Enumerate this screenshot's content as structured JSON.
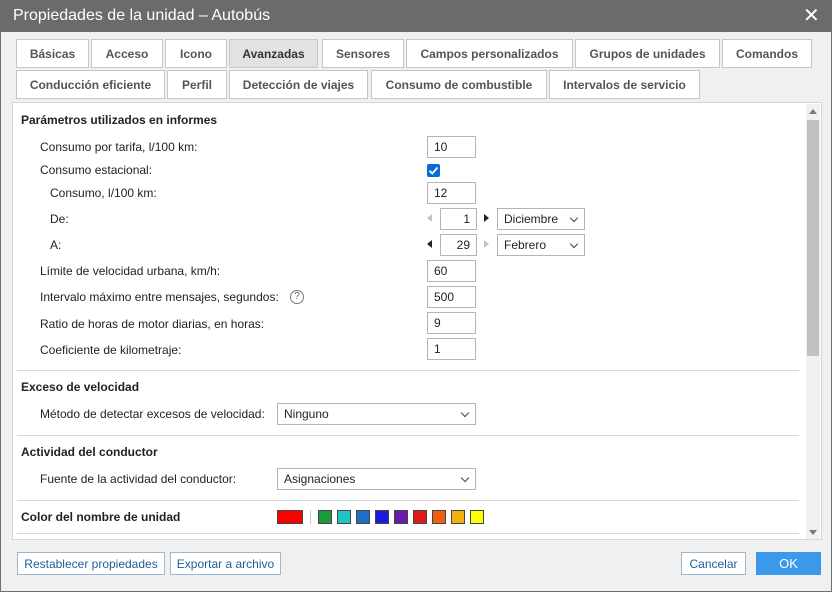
{
  "window": {
    "title": "Propiedades de la unidad – Autobús",
    "close_glyph": "✕"
  },
  "tabs": [
    {
      "label": "Básicas",
      "active": false
    },
    {
      "label": "Acceso",
      "active": false
    },
    {
      "label": "Icono",
      "active": false
    },
    {
      "label": "Avanzadas",
      "active": true
    },
    {
      "label": "Sensores",
      "active": false
    },
    {
      "label": "Campos personalizados",
      "active": false
    },
    {
      "label": "Grupos de unidades",
      "active": false
    },
    {
      "label": "Comandos",
      "active": false
    },
    {
      "label": "Conducción eficiente",
      "active": false
    },
    {
      "label": "Perfil",
      "active": false
    },
    {
      "label": "Detección de viajes",
      "active": false
    },
    {
      "label": "Consumo de combustible",
      "active": false
    },
    {
      "label": "Intervalos de servicio",
      "active": false
    }
  ],
  "report_params": {
    "title": "Parámetros utilizados en informes",
    "consumption_label": "Consumo por tarifa, l/100 km:",
    "consumption_value": "10",
    "seasonal_label": "Consumo estacional:",
    "seasonal_checked": true,
    "seasonal_consumption_label": "Consumo, l/100 km:",
    "seasonal_consumption_value": "12",
    "from_label": "De:",
    "from_day": "1",
    "from_month": "Diciembre",
    "to_label": "A:",
    "to_day": "29",
    "to_month": "Febrero",
    "urban_speed_label": "Límite de velocidad urbana, km/h:",
    "urban_speed_value": "60",
    "max_interval_label": "Intervalo máximo entre mensajes, segundos:",
    "max_interval_help": "?",
    "max_interval_value": "500",
    "engine_hours_label": "Ratio de horas de motor diarias, en horas:",
    "engine_hours_value": "9",
    "mileage_coef_label": "Coeficiente de kilometraje:",
    "mileage_coef_value": "1"
  },
  "speeding": {
    "title": "Exceso de velocidad",
    "method_label": "Método de detectar excesos de velocidad:",
    "method_value": "Ninguno"
  },
  "driver_activity": {
    "title": "Actividad del conductor",
    "source_label": "Fuente de la actividad del conductor:",
    "source_value": "Asignaciones"
  },
  "unit_name_color": {
    "title": "Color del nombre de unidad",
    "selected": "#ff0000",
    "palette": [
      "#1a9a3a",
      "#1fc3c3",
      "#1f6fc3",
      "#1a1ae0",
      "#6a1aa8",
      "#e01a1a",
      "#f06010",
      "#f0b010",
      "#ffff00"
    ]
  },
  "footer": {
    "reset_label": "Restablecer propiedades",
    "export_label": "Exportar a archivo",
    "cancel_label": "Cancelar",
    "ok_label": "OK"
  }
}
